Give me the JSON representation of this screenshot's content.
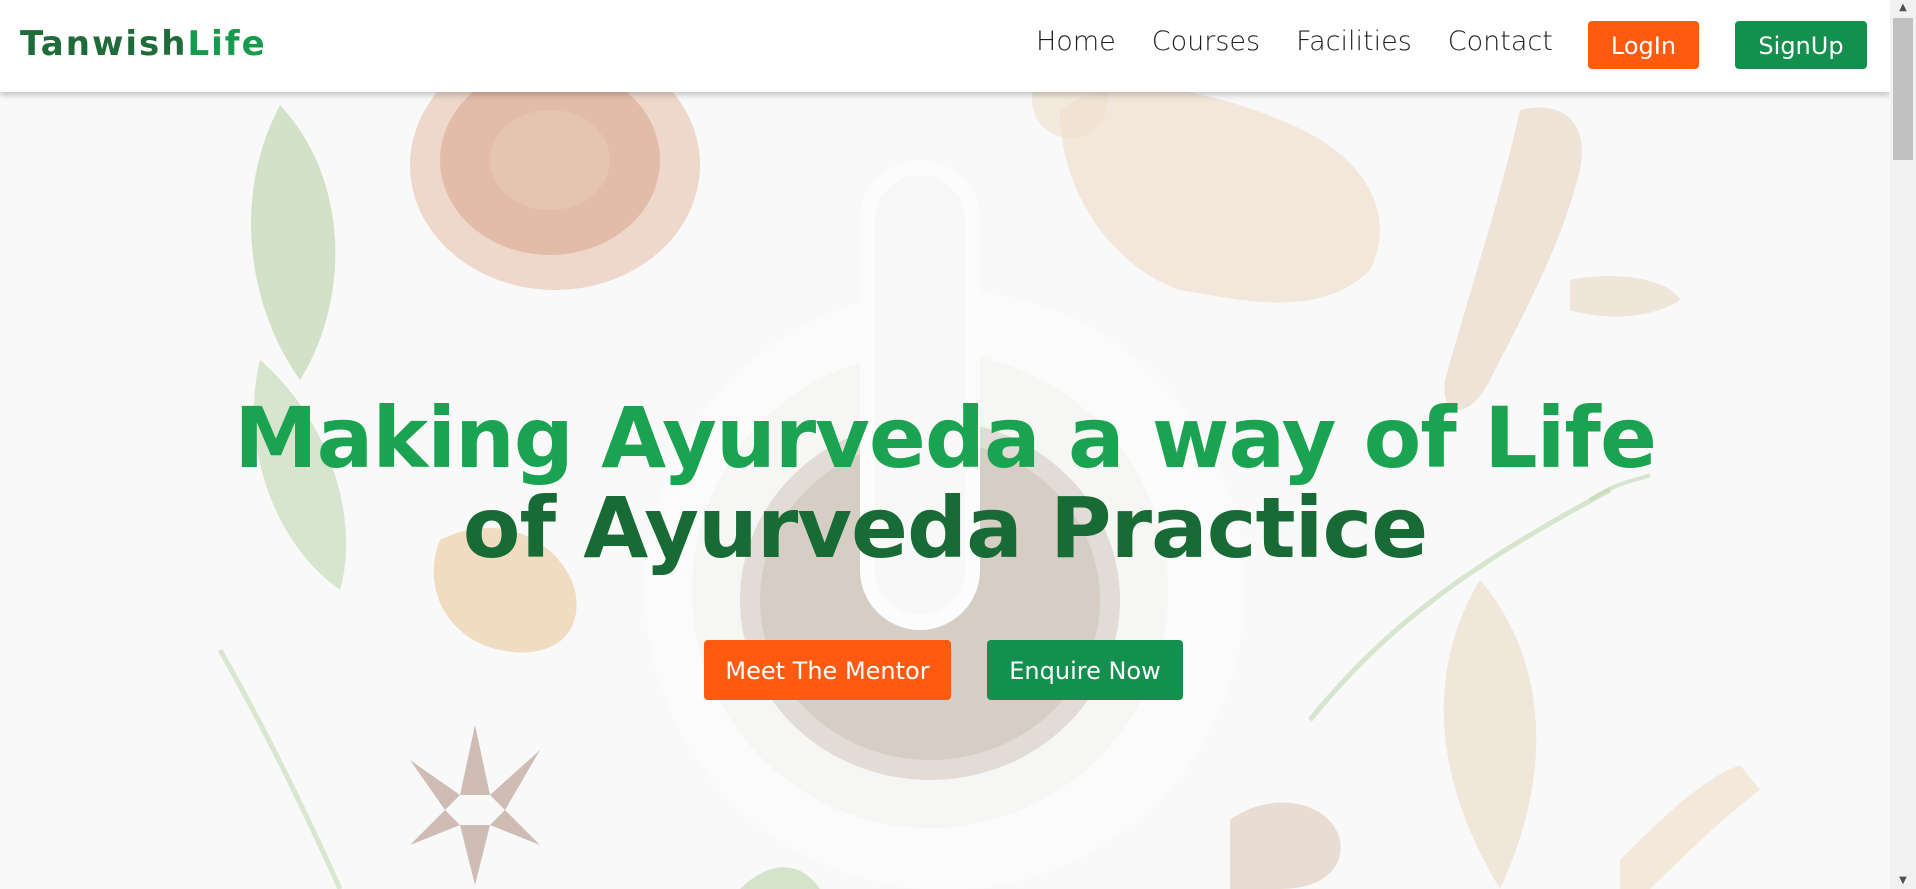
{
  "brand": {
    "part1": "Tanwish",
    "part2": "Life"
  },
  "nav": {
    "links": [
      "Home",
      "Courses",
      "Facilities",
      "Contact"
    ],
    "login_label": "LogIn",
    "signup_label": "SignUp"
  },
  "hero": {
    "headline_line1": "Making Ayurveda a way of Life",
    "headline_line2": "of Ayurveda Practice",
    "mentor_button": "Meet The Mentor",
    "enquire_button": "Enquire Now"
  },
  "colors": {
    "accent_orange": "#ff5a0f",
    "accent_green": "#13904d",
    "headline_green": "#1aa350",
    "headline_dark_green": "#186b35"
  },
  "icons": {
    "scroll_up": "triangle-up-icon",
    "scroll_down": "triangle-down-icon"
  }
}
